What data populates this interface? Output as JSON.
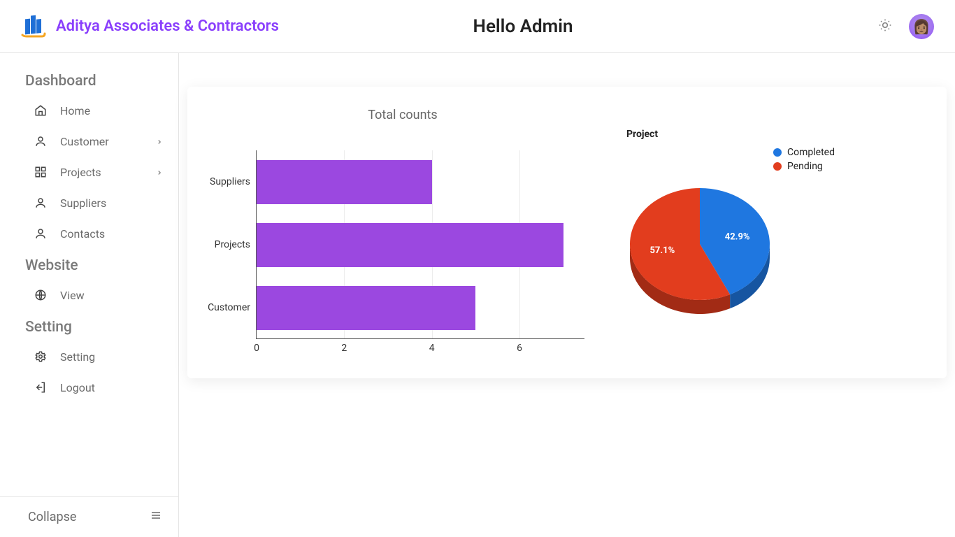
{
  "header": {
    "brand_name": "Aditya Associates & Contractors",
    "page_title": "Hello Admin"
  },
  "sidebar": {
    "sections": [
      {
        "title": "Dashboard",
        "items": [
          {
            "label": "Home",
            "icon": "home-icon",
            "has_submenu": false
          },
          {
            "label": "Customer",
            "icon": "user-icon",
            "has_submenu": true
          },
          {
            "label": "Projects",
            "icon": "grid-icon",
            "has_submenu": true
          },
          {
            "label": "Suppliers",
            "icon": "user-icon",
            "has_submenu": false
          },
          {
            "label": "Contacts",
            "icon": "user-icon",
            "has_submenu": false
          }
        ]
      },
      {
        "title": "Website",
        "items": [
          {
            "label": "View",
            "icon": "globe-icon",
            "has_submenu": false
          }
        ]
      },
      {
        "title": "Setting",
        "items": [
          {
            "label": "Setting",
            "icon": "gear-icon",
            "has_submenu": false
          },
          {
            "label": "Logout",
            "icon": "logout-icon",
            "has_submenu": false
          }
        ]
      }
    ],
    "footer": {
      "collapse_label": "Collapse"
    }
  },
  "colors": {
    "accent": "#8a3ffc",
    "bar_fill": "#9b48e0",
    "pie_completed": "#1f77e0",
    "pie_pending": "#e23d1e"
  },
  "chart_data": [
    {
      "type": "bar",
      "orientation": "horizontal",
      "title": "Total counts",
      "categories": [
        "Suppliers",
        "Projects",
        "Customer"
      ],
      "values": [
        4,
        7,
        5
      ],
      "x_ticks": [
        0,
        2,
        4,
        6
      ],
      "xlim": [
        0,
        7.5
      ]
    },
    {
      "type": "pie",
      "title": "Project",
      "series": [
        {
          "name": "Completed",
          "value": 42.9,
          "label": "42.9%",
          "color": "#1f77e0"
        },
        {
          "name": "Pending",
          "value": 57.1,
          "label": "57.1%",
          "color": "#e23d1e"
        }
      ]
    }
  ]
}
